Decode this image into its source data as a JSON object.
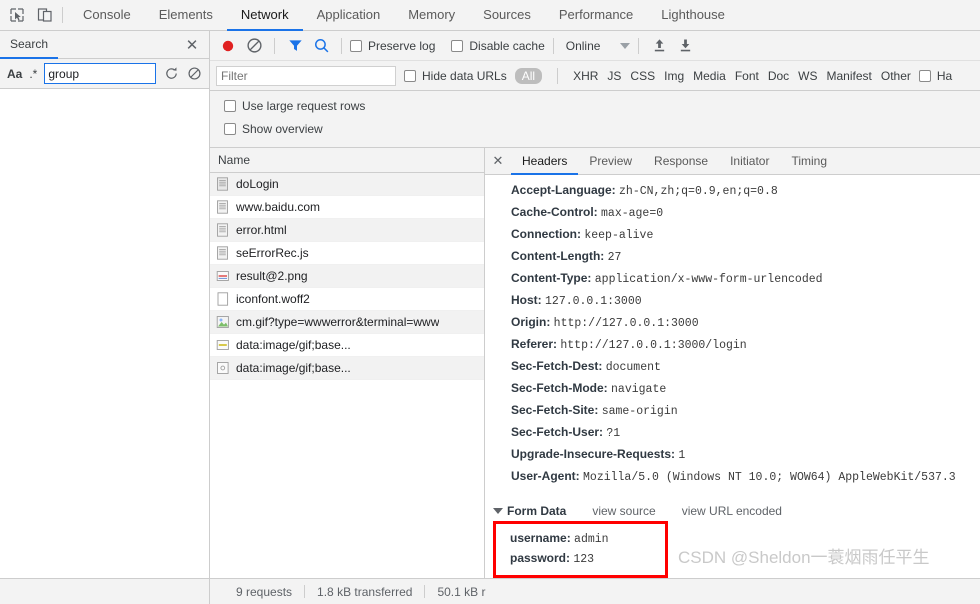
{
  "tabbar": {
    "icons": [
      {
        "name": "inspect-element-icon"
      },
      {
        "name": "device-toolbar-icon"
      }
    ],
    "tabs": [
      {
        "label": "Console",
        "active": false
      },
      {
        "label": "Elements",
        "active": false
      },
      {
        "label": "Network",
        "active": true
      },
      {
        "label": "Application",
        "active": false
      },
      {
        "label": "Memory",
        "active": false
      },
      {
        "label": "Sources",
        "active": false
      },
      {
        "label": "Performance",
        "active": false
      },
      {
        "label": "Lighthouse",
        "active": false
      }
    ]
  },
  "search_pane": {
    "title": "Search",
    "close_label": "✕",
    "match_case_label": "Aa",
    "regex_label": ".*",
    "query_value": "group",
    "query_placeholder": "",
    "refresh_icon": "refresh-icon",
    "clear_icon": "clear-icon"
  },
  "network_toolbar": {
    "record_icon": "record-button-icon",
    "clear_icon": "clear-requests-icon",
    "filter_icon": "filter-funnel-icon",
    "search_icon": "search-icon",
    "preserve_log_label": "Preserve log",
    "disable_cache_label": "Disable cache",
    "throttling_value": "Online",
    "import_icon": "import-har-icon",
    "export_icon": "export-har-icon"
  },
  "filter_bar": {
    "filter_placeholder": "Filter",
    "filter_value": "",
    "hide_data_urls_label": "Hide data URLs",
    "types": [
      {
        "label": "All",
        "active": true
      },
      {
        "label": "XHR",
        "active": false
      },
      {
        "label": "JS",
        "active": false
      },
      {
        "label": "CSS",
        "active": false
      },
      {
        "label": "Img",
        "active": false
      },
      {
        "label": "Media",
        "active": false
      },
      {
        "label": "Font",
        "active": false
      },
      {
        "label": "Doc",
        "active": false
      },
      {
        "label": "WS",
        "active": false
      },
      {
        "label": "Manifest",
        "active": false
      },
      {
        "label": "Other",
        "active": false
      }
    ],
    "has_blocked_label": "Ha"
  },
  "options": {
    "large_rows_label": "Use large request rows",
    "show_overview_label": "Show overview"
  },
  "requests": {
    "column_header": "Name",
    "rows": [
      {
        "name": "doLogin",
        "icon": "document-icon",
        "selected": true
      },
      {
        "name": "www.baidu.com",
        "icon": "document-icon",
        "selected": false
      },
      {
        "name": "error.html",
        "icon": "document-icon",
        "selected": false
      },
      {
        "name": "seErrorRec.js",
        "icon": "script-icon",
        "selected": false
      },
      {
        "name": "result@2.png",
        "icon": "image-icon",
        "selected": false
      },
      {
        "name": "iconfont.woff2",
        "icon": "font-icon",
        "selected": false
      },
      {
        "name": "cm.gif?type=wwwerror&terminal=www",
        "icon": "image-icon",
        "selected": false
      },
      {
        "name": "data:image/gif;base...",
        "icon": "image-icon",
        "selected": false
      },
      {
        "name": "data:image/gif;base...",
        "icon": "image-icon",
        "selected": false
      }
    ]
  },
  "details": {
    "close_label": "✕",
    "tabs": [
      {
        "label": "Headers",
        "active": true
      },
      {
        "label": "Preview",
        "active": false
      },
      {
        "label": "Response",
        "active": false
      },
      {
        "label": "Initiator",
        "active": false
      },
      {
        "label": "Timing",
        "active": false
      }
    ],
    "headers": [
      {
        "key": "Accept-Language:",
        "value": "zh-CN,zh;q=0.9,en;q=0.8"
      },
      {
        "key": "Cache-Control:",
        "value": "max-age=0"
      },
      {
        "key": "Connection:",
        "value": "keep-alive"
      },
      {
        "key": "Content-Length:",
        "value": "27"
      },
      {
        "key": "Content-Type:",
        "value": "application/x-www-form-urlencoded"
      },
      {
        "key": "Host:",
        "value": "127.0.0.1:3000"
      },
      {
        "key": "Origin:",
        "value": "http://127.0.0.1:3000"
      },
      {
        "key": "Referer:",
        "value": "http://127.0.0.1:3000/login"
      },
      {
        "key": "Sec-Fetch-Dest:",
        "value": "document"
      },
      {
        "key": "Sec-Fetch-Mode:",
        "value": "navigate"
      },
      {
        "key": "Sec-Fetch-Site:",
        "value": "same-origin"
      },
      {
        "key": "Sec-Fetch-User:",
        "value": "?1"
      },
      {
        "key": "Upgrade-Insecure-Requests:",
        "value": "1"
      },
      {
        "key": "User-Agent:",
        "value": "Mozilla/5.0 (Windows NT 10.0; WOW64) AppleWebKit/537.3"
      }
    ],
    "form_data": {
      "title": "Form Data",
      "view_source_label": "view source",
      "view_url_encoded_label": "view URL encoded",
      "highlight_color": "#ff0000",
      "fields": [
        {
          "key": "username:",
          "value": "admin"
        },
        {
          "key": "password:",
          "value": "123"
        }
      ]
    }
  },
  "watermark": {
    "text": "CSDN @Sheldon一蓑烟雨任平生"
  },
  "status_bar": {
    "requests": "9 requests",
    "transferred": "1.8 kB transferred",
    "resources": "50.1 kB r"
  }
}
